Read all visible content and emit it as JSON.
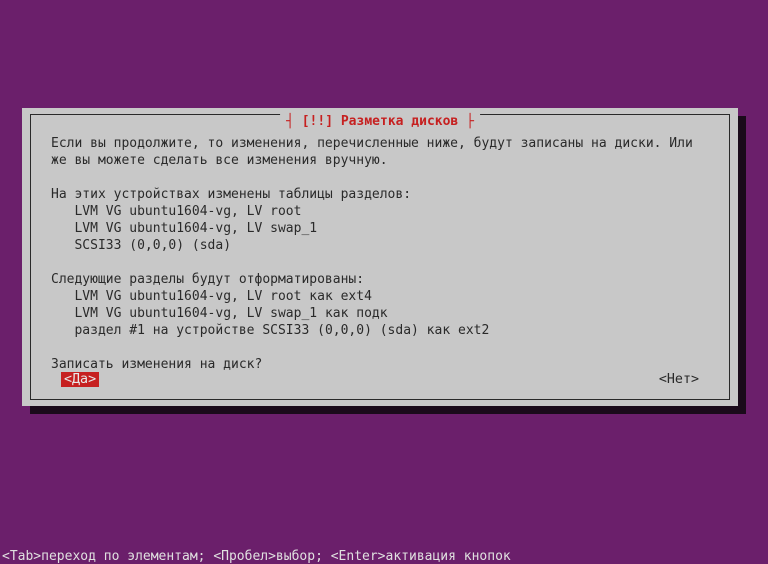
{
  "dialog": {
    "title": "[!!] Разметка дисков",
    "intro": "Если вы продолжите, то изменения, перечисленные ниже, будут записаны на диски. Или же вы можете сделать все изменения вручную.",
    "changed_heading": "На этих устройствах изменены таблицы разделов:",
    "changed_items": [
      "LVM VG ubuntu1604-vg, LV root",
      "LVM VG ubuntu1604-vg, LV swap_1",
      "SCSI33 (0,0,0) (sda)"
    ],
    "format_heading": "Следующие разделы будут отформатированы:",
    "format_items": [
      "LVM VG ubuntu1604-vg, LV root как ext4",
      "LVM VG ubuntu1604-vg, LV swap_1 как подк",
      "раздел #1 на устройстве SCSI33 (0,0,0) (sda) как ext2"
    ],
    "question": "Записать изменения на диск?",
    "yes_label": "<Да>",
    "no_label": "<Нет>"
  },
  "footer": {
    "hint": "<Tab>переход по элементам; <Пробел>выбор; <Enter>активация кнопок"
  }
}
